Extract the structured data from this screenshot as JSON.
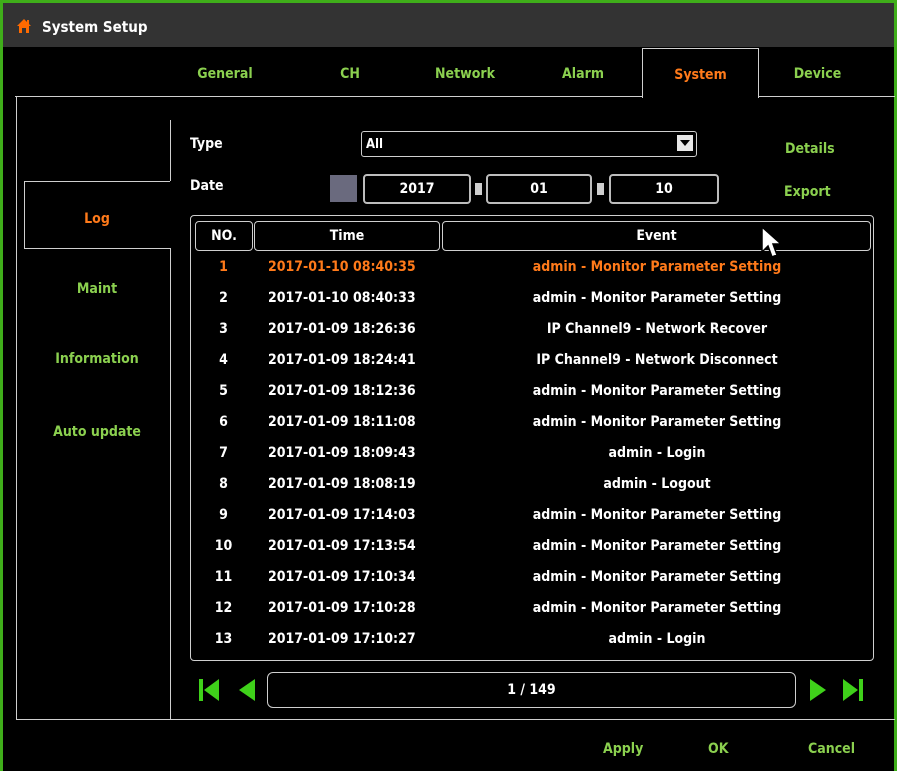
{
  "window": {
    "title": "System Setup"
  },
  "tabs": [
    {
      "label": "General"
    },
    {
      "label": "CH"
    },
    {
      "label": "Network"
    },
    {
      "label": "Alarm"
    },
    {
      "label": "System"
    },
    {
      "label": "Device"
    }
  ],
  "active_tab": "System",
  "sidebar": {
    "items": [
      {
        "label": "Log"
      },
      {
        "label": "Maint"
      },
      {
        "label": "Information"
      },
      {
        "label": "Auto update"
      }
    ],
    "active": "Log"
  },
  "filters": {
    "type_label": "Type",
    "type_value": "All",
    "date_label": "Date",
    "year": "2017",
    "month": "01",
    "day": "10",
    "details_label": "Details",
    "export_label": "Export"
  },
  "table": {
    "headers": {
      "no": "NO.",
      "time": "Time",
      "event": "Event"
    },
    "rows": [
      {
        "no": "1",
        "time": "2017-01-10 08:40:35",
        "event": "admin - Monitor Parameter Setting"
      },
      {
        "no": "2",
        "time": "2017-01-10 08:40:33",
        "event": "admin - Monitor Parameter Setting"
      },
      {
        "no": "3",
        "time": "2017-01-09 18:26:36",
        "event": "IP Channel9 - Network Recover"
      },
      {
        "no": "4",
        "time": "2017-01-09 18:24:41",
        "event": "IP Channel9 - Network Disconnect"
      },
      {
        "no": "5",
        "time": "2017-01-09 18:12:36",
        "event": "admin - Monitor Parameter Setting"
      },
      {
        "no": "6",
        "time": "2017-01-09 18:11:08",
        "event": "admin - Monitor Parameter Setting"
      },
      {
        "no": "7",
        "time": "2017-01-09 18:09:43",
        "event": "admin - Login"
      },
      {
        "no": "8",
        "time": "2017-01-09 18:08:19",
        "event": "admin - Logout"
      },
      {
        "no": "9",
        "time": "2017-01-09 17:14:03",
        "event": "admin - Monitor Parameter Setting"
      },
      {
        "no": "10",
        "time": "2017-01-09 17:13:54",
        "event": "admin - Monitor Parameter Setting"
      },
      {
        "no": "11",
        "time": "2017-01-09 17:10:34",
        "event": "admin - Monitor Parameter Setting"
      },
      {
        "no": "12",
        "time": "2017-01-09 17:10:28",
        "event": "admin - Monitor Parameter Setting"
      },
      {
        "no": "13",
        "time": "2017-01-09 17:10:27",
        "event": "admin - Login"
      }
    ],
    "selected_row": 1
  },
  "pager": {
    "text": "1 / 149"
  },
  "footer": {
    "apply": "Apply",
    "ok": "OK",
    "cancel": "Cancel"
  },
  "colors": {
    "accent_green": "#8bd04f",
    "active_orange": "#ff7a1a",
    "border_green": "#3fae1a"
  },
  "icons": [
    "home-icon",
    "dropdown-arrow-icon",
    "first-page-icon",
    "prev-page-icon",
    "next-page-icon",
    "last-page-icon",
    "mouse-cursor-icon"
  ]
}
